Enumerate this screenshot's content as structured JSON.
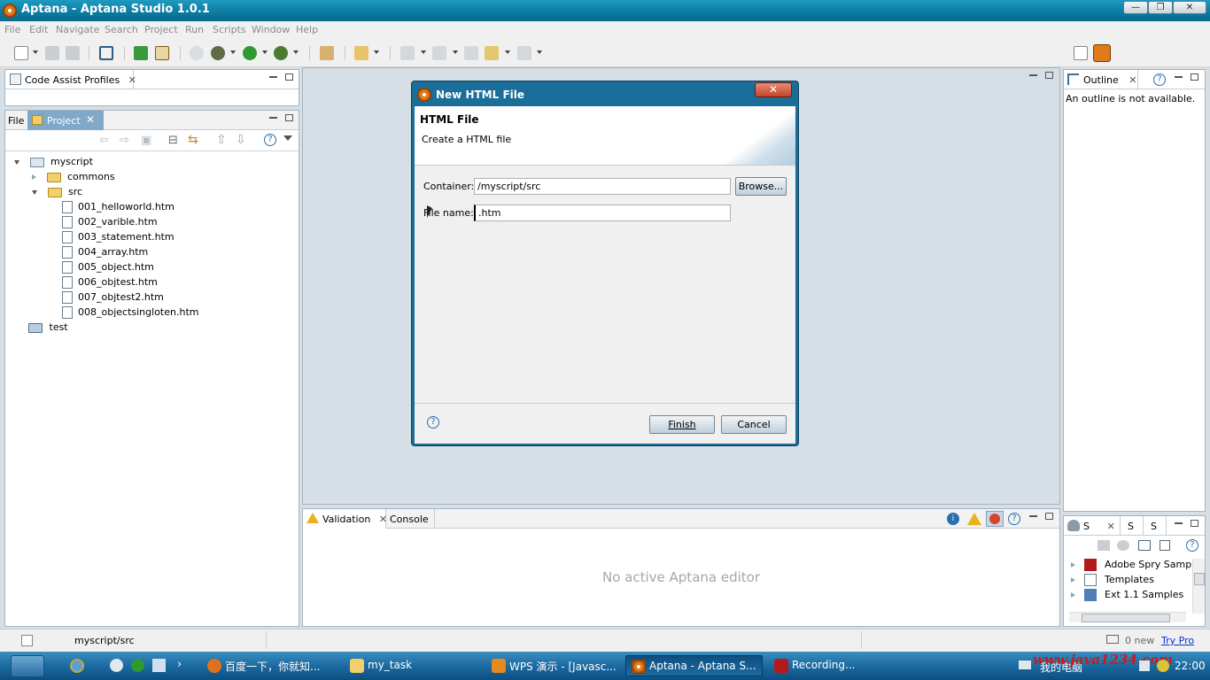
{
  "window": {
    "title": "Aptana - Aptana Studio 1.0.1",
    "controls": [
      "minimize",
      "restore",
      "close"
    ]
  },
  "menu": {
    "items": [
      "File",
      "Edit",
      "Navigate",
      "Search",
      "Project",
      "Run",
      "Scripts",
      "Window",
      "Help"
    ]
  },
  "code_assist": {
    "tab_label": "Code Assist Profiles"
  },
  "project_panel": {
    "tabs": [
      {
        "label": "File"
      },
      {
        "label": "Project"
      }
    ],
    "tree": {
      "root": "myscript",
      "commons": "commons",
      "src": "src",
      "files": [
        "001_helloworld.htm",
        "002_varible.htm",
        "003_statement.htm",
        "004_array.htm",
        "005_object.htm",
        "006_objtest.htm",
        "007_objtest2.htm",
        "008_objectsingloten.htm"
      ],
      "test": "test"
    }
  },
  "dialog": {
    "title": "New HTML File",
    "heading": "HTML File",
    "subheading": "Create a HTML file",
    "container_label": "Container:",
    "container_value": "/myscript/src",
    "browse_label": "Browse...",
    "filename_label": "File name:",
    "filename_value": ".htm",
    "finish_label": "Finish",
    "cancel_label": "Cancel"
  },
  "outline": {
    "tab_label": "Outline",
    "message": "An outline is not available."
  },
  "bottom_panel": {
    "tabs": [
      {
        "label": "Validation"
      },
      {
        "label": "Console"
      }
    ],
    "message": "No active Aptana editor"
  },
  "samples_panel": {
    "tabs": [
      "S",
      "S",
      "S"
    ],
    "items": [
      "Adobe Spry Samples",
      "Templates",
      "Ext 1.1 Samples"
    ]
  },
  "status": {
    "path": "myscript/src",
    "mail": "0 new",
    "try_pro": "Try Pro"
  },
  "taskbar": {
    "tasks": [
      {
        "label": "百度一下，你就知..."
      },
      {
        "label": "my_task"
      },
      {
        "label": "WPS 演示 - [Javasc..."
      },
      {
        "label": "Aptana - Aptana S..."
      },
      {
        "label": "Recording..."
      }
    ],
    "tray_text": "我的电脑",
    "watermark": "www.java1234.com",
    "clock": "22:00"
  },
  "colors": {
    "titlebar": "#0b7aa0",
    "dialog_frame": "#1a6e99",
    "try_pro_link": "#0033cc"
  }
}
